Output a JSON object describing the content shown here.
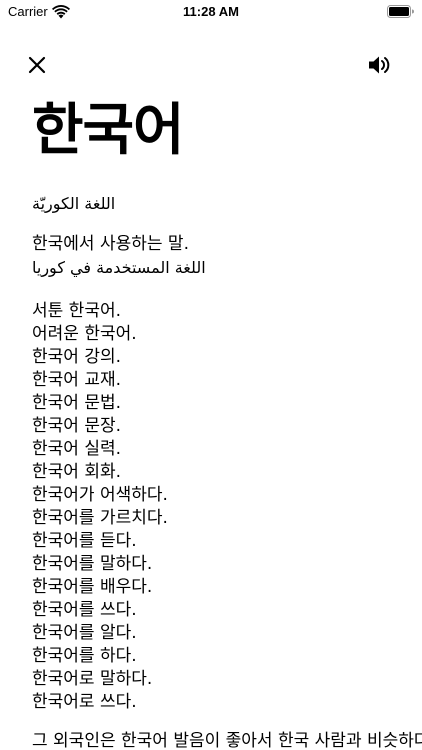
{
  "status_bar": {
    "carrier": "Carrier",
    "time": "11:28 AM"
  },
  "toolbar": {
    "close_icon": "close-icon",
    "speaker_icon": "speaker-icon"
  },
  "entry": {
    "word": "한국어",
    "translation": "اللغة الكوريّة",
    "definition": "한국에서 사용하는 말.",
    "definition_translation": "اللغة المستخدمة في كوريا",
    "examples": [
      "서툰 한국어.",
      "어려운 한국어.",
      "한국어 강의.",
      "한국어 교재.",
      "한국어 문법.",
      "한국어 문장.",
      "한국어 실력.",
      "한국어 회화.",
      "한국어가 어색하다.",
      "한국어를 가르치다.",
      "한국어를 듣다.",
      "한국어를 말하다.",
      "한국어를 배우다.",
      "한국어를 쓰다.",
      "한국어를 알다.",
      "한국어를 하다.",
      "한국어로 말하다.",
      "한국어로 쓰다."
    ],
    "footer": "그 외국인은 한국어 발음이 좋아서 한국 사람과 비슷하다."
  },
  "colors": {
    "text": "#000000",
    "background": "#ffffff"
  }
}
